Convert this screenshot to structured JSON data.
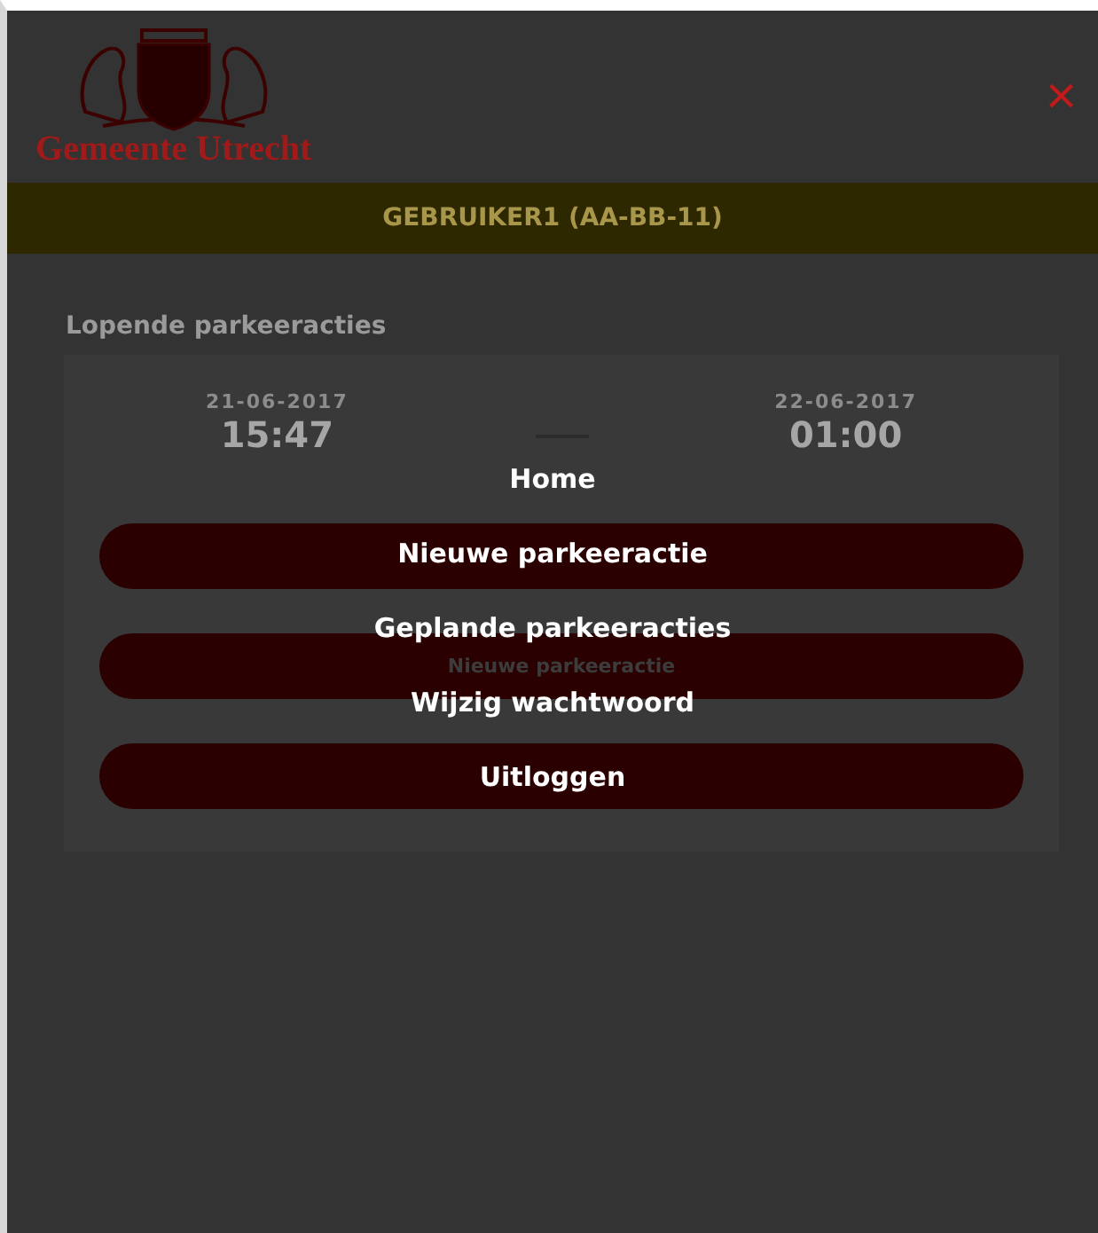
{
  "header": {
    "logo_text": "Gemeente Utrecht",
    "close": "×"
  },
  "user_bar": {
    "label": "GEBRUIKER1 (AA-BB-11)"
  },
  "section_title": "Lopende parkeeracties",
  "parking": {
    "start_date": "21-06-2017",
    "start_time": "15:47",
    "end_date": "22-06-2017",
    "end_time": "01:00"
  },
  "card_buttons": [
    {
      "kind": "blank"
    },
    {
      "kind": "labeled",
      "label": "Nieuwe parkeeractie"
    },
    {
      "kind": "blank"
    }
  ],
  "menu": [
    {
      "label": "Home"
    },
    {
      "label": "Nieuwe parkeeractie"
    },
    {
      "label": "Geplande parkeeracties"
    },
    {
      "label": "Wijzig wachtwoord"
    },
    {
      "label": "Uitloggen"
    }
  ]
}
